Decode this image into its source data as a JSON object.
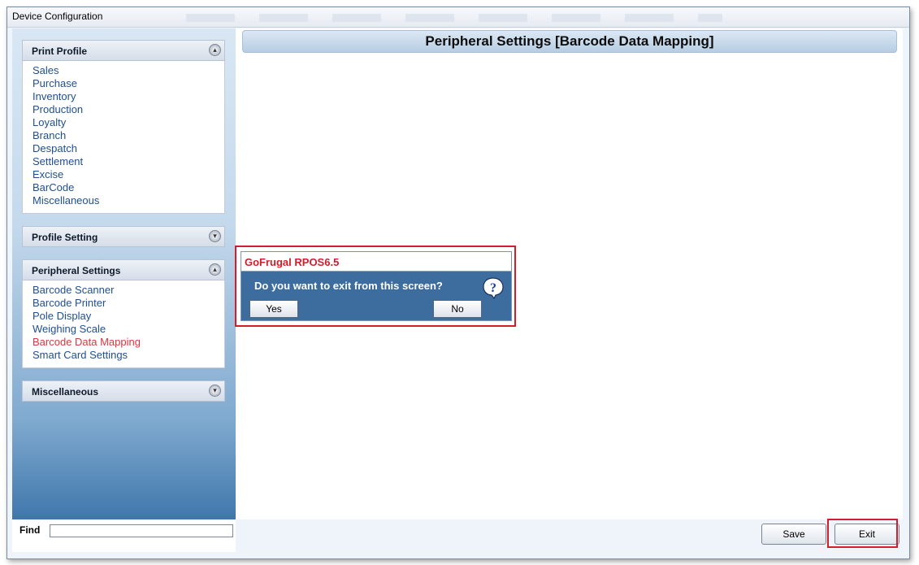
{
  "window": {
    "title": "Device Configuration"
  },
  "sidebar": {
    "sections": [
      {
        "title": "Print Profile",
        "expanded": true,
        "items": [
          "Sales",
          "Purchase",
          "Inventory",
          "Production",
          "Loyalty",
          "Branch",
          "Despatch",
          "Settlement",
          "Excise",
          "BarCode",
          "Miscellaneous"
        ]
      },
      {
        "title": "Profile Setting",
        "expanded": false,
        "items": []
      },
      {
        "title": "Peripheral Settings",
        "expanded": true,
        "items": [
          "Barcode Scanner",
          "Barcode Printer",
          "Pole Display",
          "Weighing Scale",
          "Barcode Data Mapping",
          "Smart Card Settings"
        ],
        "active_item": "Barcode Data Mapping"
      },
      {
        "title": "Miscellaneous",
        "expanded": false,
        "items": []
      }
    ],
    "find_label": "Find",
    "find_value": ""
  },
  "main": {
    "title": "Peripheral Settings [Barcode Data Mapping]"
  },
  "dialog": {
    "title": "GoFrugal RPOS6.5",
    "message": "Do you want to exit from this screen?",
    "yes_label": "Yes",
    "no_label": "No",
    "icon": "question-icon"
  },
  "footer": {
    "save_label": "Save",
    "exit_label": "Exit"
  },
  "colors": {
    "accent_red": "#d21d2b",
    "dialog_blue": "#3c6d9e",
    "link_blue": "#1f4f8f",
    "active_item": "#d8383f"
  }
}
